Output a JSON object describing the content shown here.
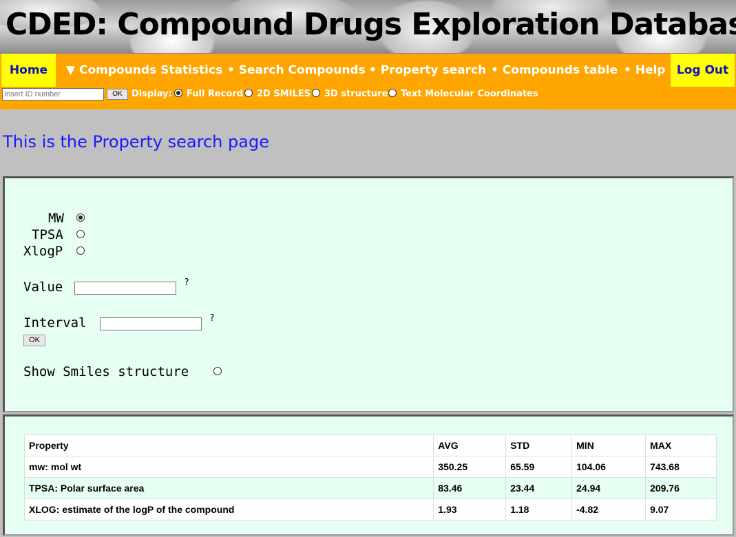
{
  "header": {
    "title": "CDED: Compound Drugs Exploration Database"
  },
  "nav": {
    "home": "Home",
    "compounds_statistics": "▼ Compounds Statistics",
    "search_compounds": "• Search Compounds",
    "property_search": "• Property search",
    "compounds_table": "• Compounds table",
    "help": "• Help",
    "logout": "Log Out"
  },
  "subbar": {
    "id_placeholder": "Insert ID number",
    "ok": "OK",
    "display_label": "Display:",
    "options": [
      "Full Record",
      "2D SMILES",
      "3D structure",
      "Text Molecular Coordinates"
    ],
    "selected": "Full Record"
  },
  "page": {
    "heading": "This is the Property search page"
  },
  "form": {
    "properties": [
      "MW",
      "TPSA",
      "XlogP"
    ],
    "selected_property": "MW",
    "value_label": "Value",
    "interval_label": "Interval",
    "help_mark": "?",
    "ok": "OK",
    "show_smiles_label": "Show Smiles structure"
  },
  "stats_table": {
    "headers": [
      "Property",
      "AVG",
      "STD",
      "MIN",
      "MAX"
    ],
    "rows": [
      [
        "mw: mol wt",
        "350.25",
        "65.59",
        "104.06",
        "743.68"
      ],
      [
        "TPSA: Polar surface area",
        "83.46",
        "23.44",
        "24.94",
        "209.76"
      ],
      [
        "XLOG: estimate of the logP of the compound",
        "1.93",
        "1.18",
        "-4.82",
        "9.07"
      ]
    ]
  },
  "colors": {
    "nav_bg": "#ffa500",
    "nav_highlight": "#ffff00",
    "panel_bg": "#e6fff2",
    "page_bg": "#c0c0c0",
    "heading": "#1a1aff"
  }
}
